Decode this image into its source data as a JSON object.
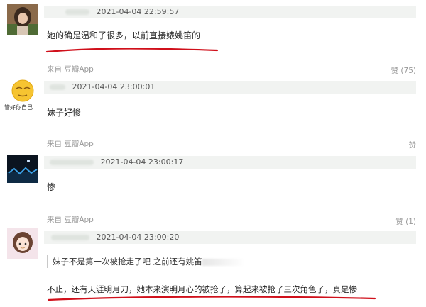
{
  "comments": [
    {
      "timestamp": "2021-04-04 22:59:57",
      "text": "她的确是温和了很多，以前直接婊姚笛的",
      "source": "来自 豆瓣App",
      "like": "赞 (75)"
    },
    {
      "avatar_caption": "管好你自己",
      "timestamp": "2021-04-04 23:00:01",
      "text": "妹子好惨",
      "source": "来自 豆瓣App",
      "like": "赞"
    },
    {
      "timestamp": "2021-04-04 23:00:17",
      "text": "惨",
      "source": "来自 豆瓣App",
      "like": "赞 (1)"
    },
    {
      "timestamp": "2021-04-04 23:00:20",
      "quote": "妹子不是第一次被抢走了吧 之前还有姚笛",
      "text": "不止，还有天涯明月刀，她本来演明月心的被抢了，算起来被抢了三次角色了，真是惨"
    }
  ],
  "colors": {
    "underline": "#d0101b",
    "headbar_bg": "#f1f3f1"
  }
}
